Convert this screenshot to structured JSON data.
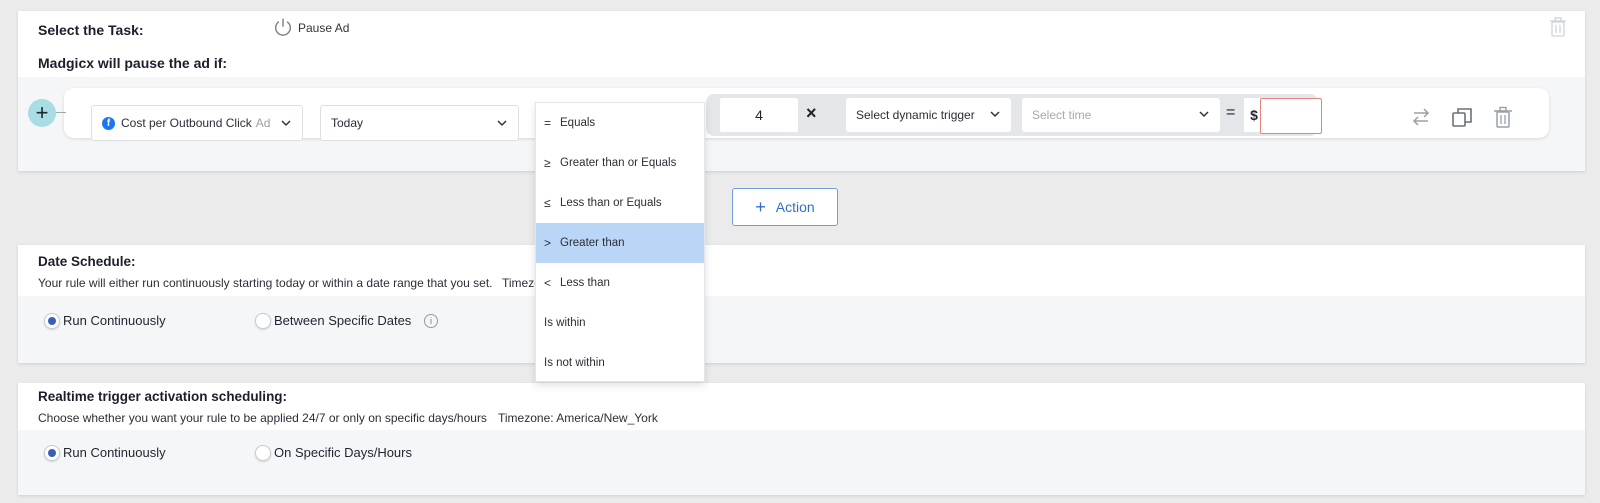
{
  "task": {
    "select_label": "Select the Task:",
    "pause_label": "Pause Ad",
    "condition_heading": "Madgicx will pause the ad if:"
  },
  "condition": {
    "metric": "Cost per Outbound Click",
    "metric_suffix": "Ad",
    "period": "Today",
    "multiplier": "4",
    "times_symbol": "×",
    "dynamic_trigger": "Select dynamic trigger",
    "time_placeholder": "Select time",
    "equals_symbol": "=",
    "currency": "$"
  },
  "action_button": {
    "plus": "+",
    "label": "Action"
  },
  "operator_dropdown": {
    "items": [
      {
        "symbol": "=",
        "label": "Equals",
        "selected": false
      },
      {
        "symbol": "≥",
        "label": "Greater than or Equals",
        "selected": false
      },
      {
        "symbol": "≤",
        "label": "Less than or Equals",
        "selected": false
      },
      {
        "symbol": ">",
        "label": "Greater than",
        "selected": true
      },
      {
        "symbol": "<",
        "label": "Less than",
        "selected": false
      },
      {
        "symbol": "",
        "label": "Is within",
        "selected": false
      },
      {
        "symbol": "",
        "label": "Is not within",
        "selected": false
      }
    ],
    "selected_color": "#b9d6f7"
  },
  "date_schedule": {
    "title": "Date Schedule:",
    "description": "Your rule will either run continuously starting today or within a date range that you set.",
    "timezone_partial": "Timezo",
    "option_continuous": "Run Continuously",
    "option_dates": "Between Specific Dates",
    "selected": "Run Continuously"
  },
  "realtime_schedule": {
    "title": "Realtime trigger activation scheduling:",
    "description": "Choose whether you want your rule to be applied 24/7 or only on specific days/hours",
    "timezone": "Timezone: America/New_York",
    "option_continuous": "Run Continuously",
    "option_days": "On Specific Days/Hours",
    "selected": "Run Continuously"
  },
  "colors": {
    "accent": "#3a5fb8",
    "button_blue": "#2f6fce",
    "plus_teal": "#a8dde3",
    "error_border": "#e4847a"
  },
  "icons": [
    "power-icon",
    "trash-icon",
    "plus-icon",
    "facebook-icon",
    "chevron-down-icon",
    "swap-icon",
    "copy-icon",
    "info-icon"
  ]
}
